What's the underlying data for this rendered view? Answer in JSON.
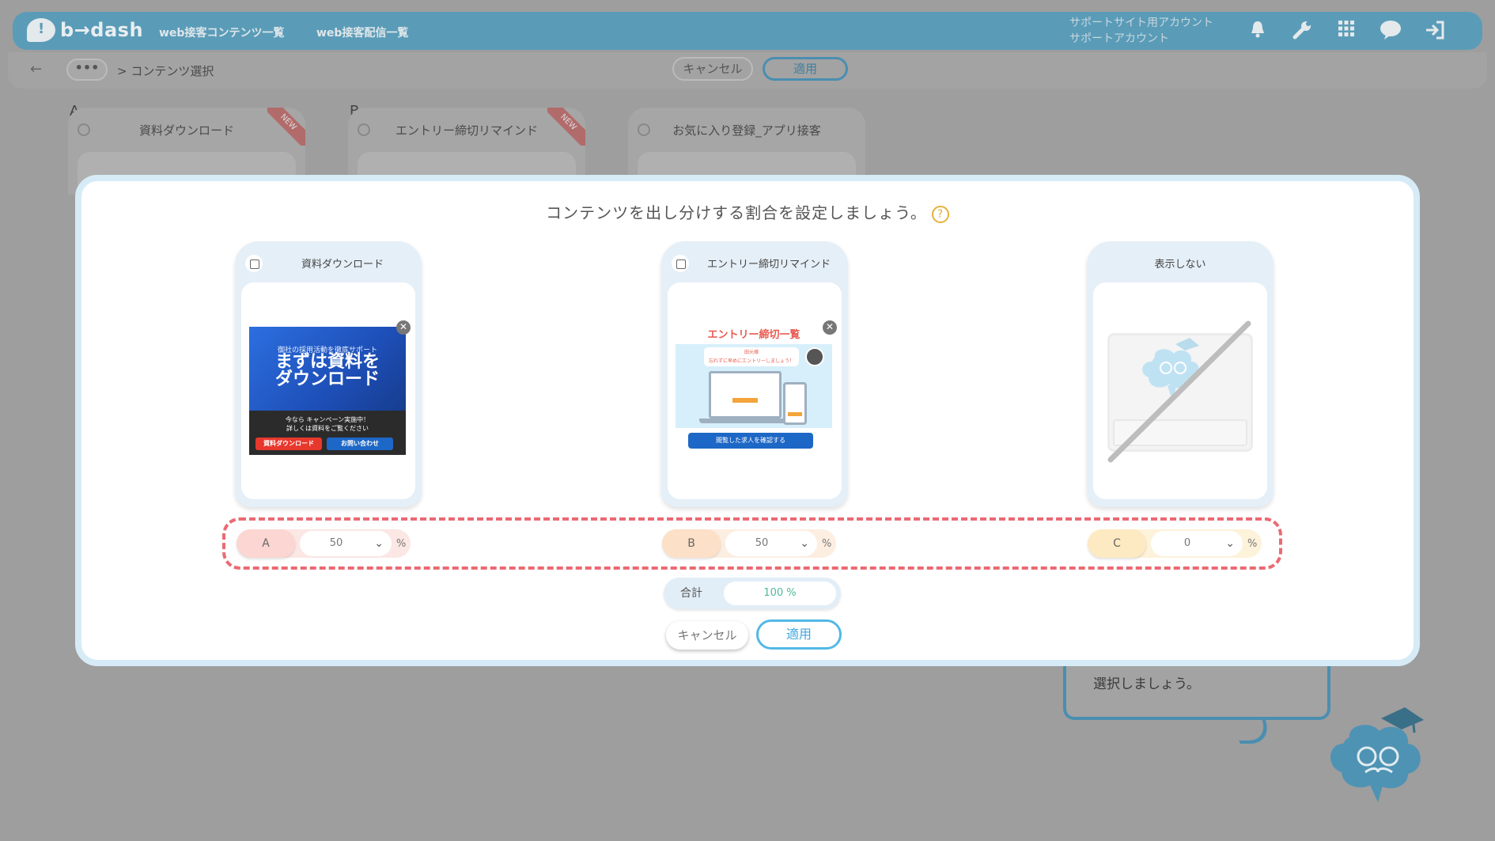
{
  "app": {
    "logo_text": "b→dash",
    "nav": [
      "web接客コンテンツ一覧",
      "web接客配信一覧"
    ],
    "account_line1": "サポートサイト用アカウント",
    "account_line2": "サポートアカウント",
    "icons": [
      "bell-icon",
      "wrench-icon",
      "apps-grid-icon",
      "chat-icon",
      "logout-icon"
    ]
  },
  "subbar": {
    "dots": "•••",
    "breadcrumb": "> コンテンツ選択",
    "cancel_label": "キャンセル",
    "apply_label": "適用"
  },
  "background_cards": [
    {
      "letter": "A",
      "title": "資料ダウンロード",
      "badge": "NEW"
    },
    {
      "letter": "B",
      "title": "エントリー締切リマインド",
      "badge": "NEW"
    },
    {
      "letter": "",
      "title": "お気に入り登録_アプリ接客",
      "badge": ""
    }
  ],
  "tip_bubble": {
    "text": "選択しましょう。"
  },
  "modal": {
    "title": "コンテンツを出し分けする割合を設定しましょう。",
    "help_symbol": "?",
    "cards": [
      {
        "title": "資料ダウンロード"
      },
      {
        "title": "エントリー締切リマインド"
      },
      {
        "title": "表示しない"
      }
    ],
    "banner_a": {
      "sub": "御社の採用活動を徹底サポート",
      "big_line1": "まずは資料を",
      "big_line2": "ダウンロード",
      "campaign_line1": "今なら キャンペーン実施中！",
      "campaign_line2": "詳しくは資料をご覧ください",
      "btn_download": "資料ダウンロード",
      "btn_contact": "お問い合わせ"
    },
    "banner_b": {
      "heading": "エントリー締切一覧",
      "speech_line1": "田元様",
      "speech_line2": "忘れずに早めにエントリーしましょう！",
      "button": "閲覧した求人を確認する"
    },
    "ratios": [
      {
        "label": "A",
        "value": "50",
        "unit": "%",
        "color": "#fbd6d2"
      },
      {
        "label": "B",
        "value": "50",
        "unit": "%",
        "color": "#fde0c8"
      },
      {
        "label": "C",
        "value": "0",
        "unit": "%",
        "color": "#fdeac2"
      }
    ],
    "total": {
      "label": "合計",
      "value": "100 %"
    },
    "cancel_label": "キャンセル",
    "apply_label": "適用"
  }
}
